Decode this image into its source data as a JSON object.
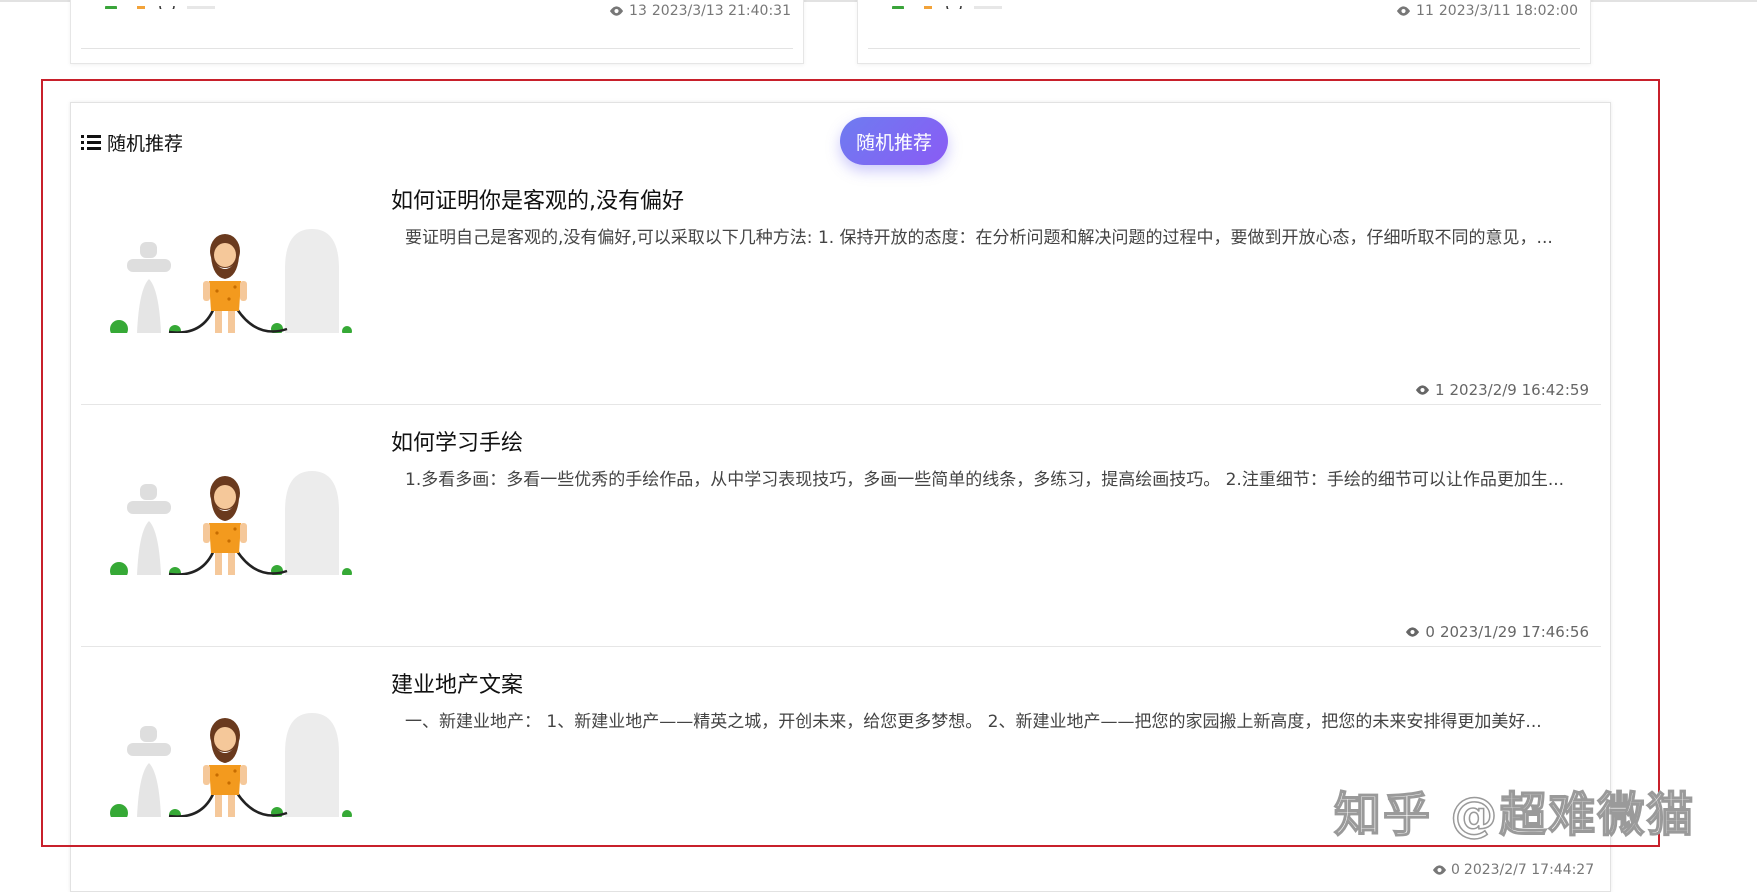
{
  "top_cards": [
    {
      "views": "13",
      "date": "2023/3/13 21:40:31"
    },
    {
      "views": "11",
      "date": "2023/3/11 18:02:00"
    }
  ],
  "panel": {
    "heading": "随机推荐",
    "random_button": "随机推荐",
    "items": [
      {
        "title": "如何证明你是客观的,没有偏好",
        "excerpt": "要证明自己是客观的,没有偏好,可以采取以下几种方法: 1. 保持开放的态度：在分析问题和解决问题的过程中，要做到开放心态，仔细听取不同的意见，...",
        "views": "1",
        "date": "2023/2/9 16:42:59"
      },
      {
        "title": "如何学习手绘",
        "excerpt": "1.多看多画：多看一些优秀的手绘作品，从中学习表现技巧，多画一些简单的线条，多练习，提高绘画技巧。 2.注重细节：手绘的细节可以让作品更加生...",
        "views": "0",
        "date": "2023/1/29 17:46:56"
      },
      {
        "title": "建业地产文案",
        "excerpt": "一、新建业地产： 1、新建业地产——精英之城，开创未来，给您更多梦想。 2、新建业地产——把您的家园搬上新高度，把您的未来安排得更加美好...",
        "views": "0",
        "date": "2023/2/7 17:44:27"
      }
    ]
  },
  "watermark": "知乎 @超难微猫",
  "colors": {
    "highlight_frame": "#c8202b",
    "button_gradient_start": "#6e7cf0",
    "button_gradient_end": "#8a5bf5"
  },
  "icons": {
    "views": "eye-icon",
    "heading": "list-icon",
    "thumbnail": "caveman-illustration"
  }
}
